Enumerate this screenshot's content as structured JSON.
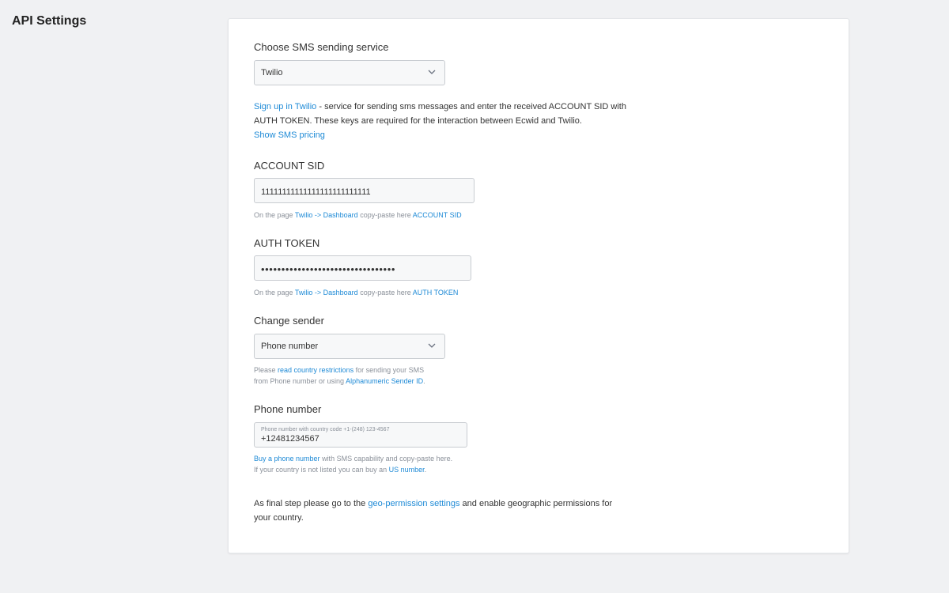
{
  "page": {
    "title": "API Settings"
  },
  "service": {
    "heading": "Choose SMS sending service",
    "selected": "Twilio",
    "info_link": "Sign up in Twilio",
    "info_text_1": " - service for sending sms messages and enter the received ACCOUNT SID with",
    "info_text_2": "AUTH TOKEN. These keys are required for the interaction between Ecwid and Twilio.",
    "pricing_link": "Show SMS pricing"
  },
  "account_sid": {
    "heading": "ACCOUNT SID",
    "value": "11111111111111111111111111",
    "hint_prefix": "On the page ",
    "hint_link1": "Twilio -> Dashboard",
    "hint_middle": " copy-paste here ",
    "hint_link2": "ACCOUNT SID"
  },
  "auth_token": {
    "heading": "AUTH TOKEN",
    "value": "•••••••••••••••••••••••••••••••••",
    "hint_prefix": "On the page ",
    "hint_link1": "Twilio -> Dashboard",
    "hint_middle": " copy-paste here ",
    "hint_link2": "AUTH TOKEN"
  },
  "sender": {
    "heading": "Change sender",
    "selected": "Phone number",
    "hint_prefix": "Please ",
    "hint_link1": "read country restrictions",
    "hint_middle": " for sending your SMS",
    "hint_line2_prefix": "from Phone number or using ",
    "hint_link2": "Alphanumeric Sender ID",
    "hint_line2_suffix": "."
  },
  "phone": {
    "heading": "Phone number",
    "field_label": "Phone number with country code +1-(248) 123-4567",
    "value": "+12481234567",
    "hint_link1": "Buy a phone number",
    "hint_text1": " with SMS capability and copy-paste here.",
    "hint_line2_prefix": "If your country is not listed you can buy an ",
    "hint_link2": "US number",
    "hint_line2_suffix": "."
  },
  "final": {
    "prefix": "As final step please go to the ",
    "link": "geo-permission settings",
    "suffix": " and enable geographic permissions for",
    "line2": "your country."
  }
}
